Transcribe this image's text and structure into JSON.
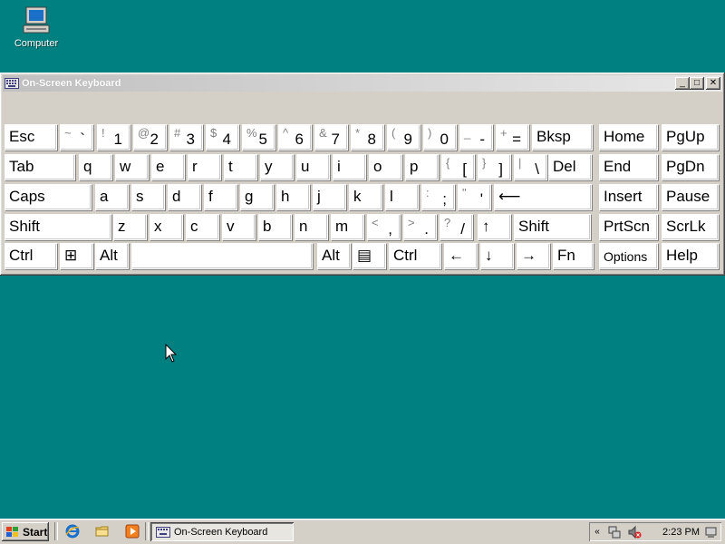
{
  "desktop": {
    "icons": [
      {
        "label": "Computer",
        "icon": "computer-icon"
      }
    ],
    "background_color": "#008080"
  },
  "window": {
    "title": "On-Screen Keyboard",
    "controls": {
      "minimize": "_",
      "maximize": "□",
      "close": "✕"
    }
  },
  "keyboard": {
    "rows": [
      [
        {
          "main": "Esc"
        },
        {
          "shift": "~",
          "main": "`"
        },
        {
          "shift": "!",
          "main": "1"
        },
        {
          "shift": "@",
          "main": "2"
        },
        {
          "shift": "#",
          "main": "3"
        },
        {
          "shift": "$",
          "main": "4"
        },
        {
          "shift": "%",
          "main": "5"
        },
        {
          "shift": "^",
          "main": "6"
        },
        {
          "shift": "&",
          "main": "7"
        },
        {
          "shift": "*",
          "main": "8"
        },
        {
          "shift": "(",
          "main": "9"
        },
        {
          "shift": ")",
          "main": "0"
        },
        {
          "shift": "_",
          "main": "-"
        },
        {
          "shift": "+",
          "main": "="
        },
        {
          "main": "Bksp"
        },
        {
          "main": "Home"
        },
        {
          "main": "PgUp"
        }
      ],
      [
        {
          "main": "Tab"
        },
        {
          "main": "q"
        },
        {
          "main": "w"
        },
        {
          "main": "e"
        },
        {
          "main": "r"
        },
        {
          "main": "t"
        },
        {
          "main": "y"
        },
        {
          "main": "u"
        },
        {
          "main": "i"
        },
        {
          "main": "o"
        },
        {
          "main": "p"
        },
        {
          "shift": "{",
          "main": "["
        },
        {
          "shift": "}",
          "main": "]"
        },
        {
          "shift": "|",
          "main": "\\"
        },
        {
          "main": "Del"
        },
        {
          "main": "End"
        },
        {
          "main": "PgDn"
        }
      ],
      [
        {
          "main": "Caps"
        },
        {
          "main": "a"
        },
        {
          "main": "s"
        },
        {
          "main": "d"
        },
        {
          "main": "f"
        },
        {
          "main": "g"
        },
        {
          "main": "h"
        },
        {
          "main": "j"
        },
        {
          "main": "k"
        },
        {
          "main": "l"
        },
        {
          "shift": ":",
          "main": ";"
        },
        {
          "shift": "\"",
          "main": "'"
        },
        {
          "main": "⟵"
        },
        {
          "main": "Insert"
        },
        {
          "main": "Pause"
        }
      ],
      [
        {
          "main": "Shift"
        },
        {
          "main": "z"
        },
        {
          "main": "x"
        },
        {
          "main": "c"
        },
        {
          "main": "v"
        },
        {
          "main": "b"
        },
        {
          "main": "n"
        },
        {
          "main": "m"
        },
        {
          "shift": "<",
          "main": ","
        },
        {
          "shift": ">",
          "main": "."
        },
        {
          "shift": "?",
          "main": "/"
        },
        {
          "main": "↑"
        },
        {
          "main": "Shift"
        },
        {
          "main": "PrtScn"
        },
        {
          "main": "ScrLk"
        }
      ],
      [
        {
          "main": "Ctrl"
        },
        {
          "main": "⊞"
        },
        {
          "main": "Alt"
        },
        {
          "main": ""
        },
        {
          "main": "Alt"
        },
        {
          "main": "▤"
        },
        {
          "main": "Ctrl"
        },
        {
          "main": "←"
        },
        {
          "main": "↓"
        },
        {
          "main": "→"
        },
        {
          "main": "Fn"
        },
        {
          "main": "Options"
        },
        {
          "main": "Help"
        }
      ]
    ]
  },
  "taskbar": {
    "start_label": "Start",
    "quicklaunch": [
      "ie-icon",
      "folder-icon",
      "media-player-icon"
    ],
    "tasks": [
      {
        "label": "On-Screen Keyboard"
      }
    ],
    "tray": {
      "time": "2:23 PM"
    }
  }
}
